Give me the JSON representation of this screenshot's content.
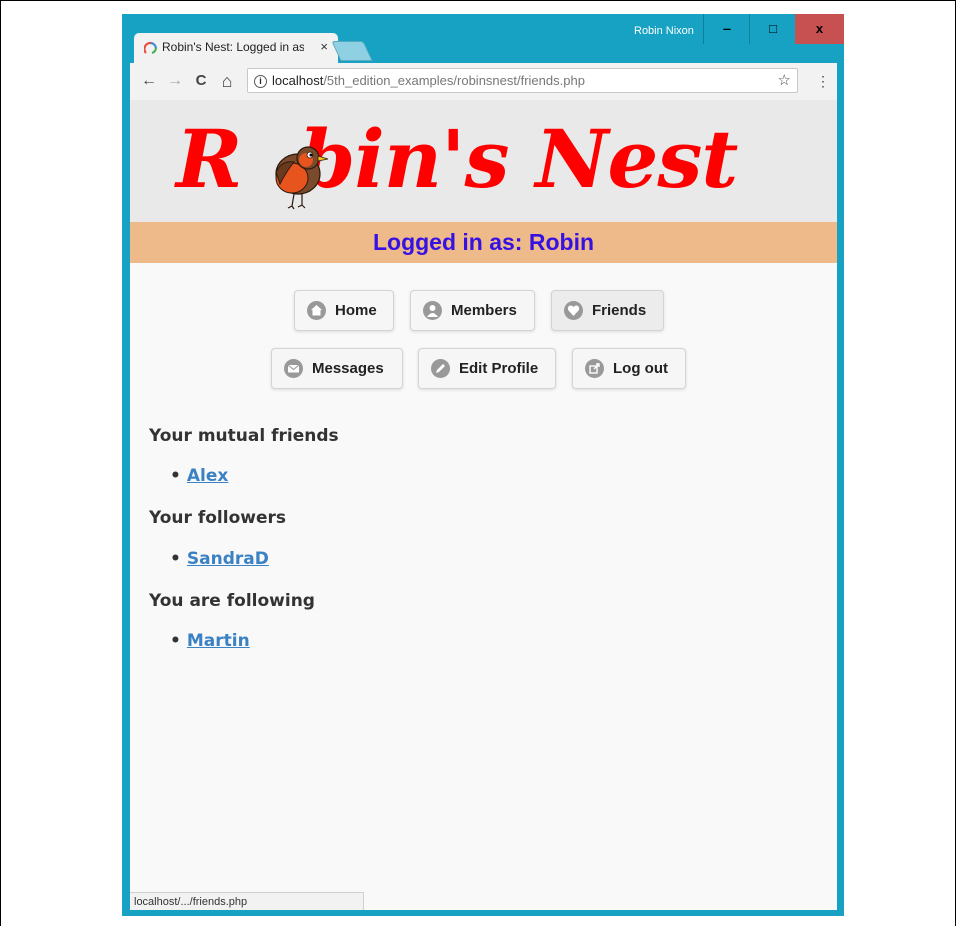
{
  "window": {
    "user_name": "Robin Nixon",
    "controls": {
      "minimize": "‒",
      "maximize": "□",
      "close": "x"
    }
  },
  "tab": {
    "title": "Robin's Nest: Logged in as Robin",
    "close": "×"
  },
  "toolbar": {
    "back": "←",
    "forward": "→",
    "reload": "C",
    "home": "⌂",
    "info": "i",
    "url_host": "localhost",
    "url_path": "/5th_edition_examples/robinsnest/friends.php",
    "star": "☆",
    "menu": "⋮"
  },
  "page": {
    "logo": {
      "before": "R",
      "after": "bin's Nest"
    },
    "logged_in": "Logged in as: Robin",
    "nav": [
      {
        "label": "Home",
        "icon": "home-icon"
      },
      {
        "label": "Members",
        "icon": "person-icon"
      },
      {
        "label": "Friends",
        "icon": "heart-icon"
      },
      {
        "label": "Messages",
        "icon": "mail-icon"
      },
      {
        "label": "Edit Profile",
        "icon": "pencil-icon"
      },
      {
        "label": "Log out",
        "icon": "logout-icon"
      }
    ],
    "sections": [
      {
        "title": "Your mutual friends",
        "items": [
          "Alex"
        ]
      },
      {
        "title": "Your followers",
        "items": [
          "SandraD"
        ]
      },
      {
        "title": "You are following",
        "items": [
          "Martin"
        ]
      }
    ]
  },
  "status_bar": {
    "text": "localhost/.../friends.php"
  },
  "colors": {
    "frame": "#17a1c3",
    "logo": "#ff0000",
    "logged_bar": "#efba89",
    "logged_text": "#3611e3",
    "link": "#3b82c4",
    "close": "#c75050"
  }
}
